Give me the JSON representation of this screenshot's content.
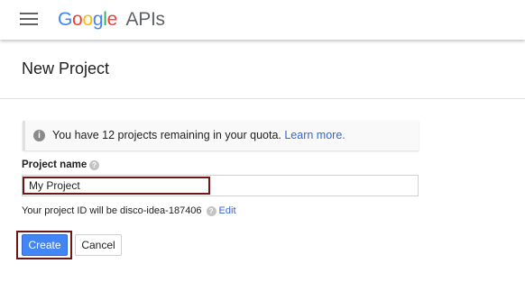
{
  "header": {
    "logo_google_letters": [
      {
        "char": "G",
        "color": "#4285F4"
      },
      {
        "char": "o",
        "color": "#EA4335"
      },
      {
        "char": "o",
        "color": "#FBBC05"
      },
      {
        "char": "g",
        "color": "#4285F4"
      },
      {
        "char": "l",
        "color": "#34A853"
      },
      {
        "char": "e",
        "color": "#EA4335"
      }
    ],
    "logo_suffix": "APIs",
    "menu_icon": "hamburger-menu-icon"
  },
  "page": {
    "title": "New Project"
  },
  "notice": {
    "icon": "info-icon",
    "text": "You have 12 projects remaining in your quota.",
    "link_label": "Learn more."
  },
  "form": {
    "project_name_label": "Project name",
    "project_name_value": "My Project",
    "project_id_text": "Your project ID will be disco-idea-187406",
    "edit_link_label": "Edit",
    "help_icon": "question-mark-icon"
  },
  "actions": {
    "create_label": "Create",
    "cancel_label": "Cancel"
  },
  "colors": {
    "primary_button": "#4285f4",
    "link": "#3367d6",
    "highlight_outline": "#6e1717"
  }
}
